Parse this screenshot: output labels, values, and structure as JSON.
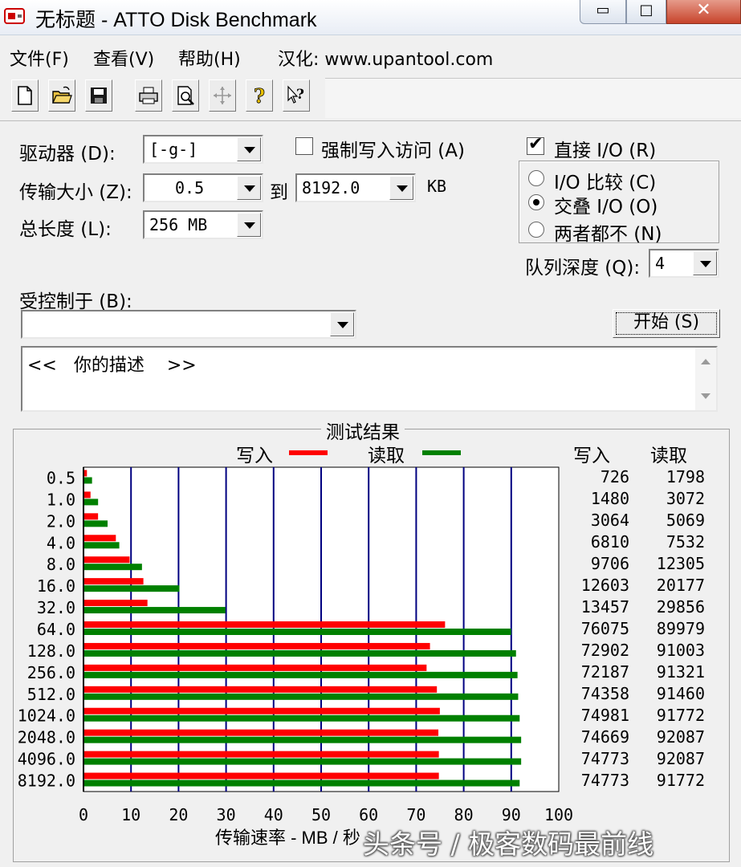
{
  "window": {
    "title": "无标题 - ATTO Disk Benchmark",
    "min_glyph": "▭",
    "max_glyph": "□",
    "close_glyph": "✕"
  },
  "menu": {
    "file": "文件(F)",
    "view": "查看(V)",
    "help": "帮助(H)",
    "localize": "汉化: www.upantool.com"
  },
  "toolbar": {
    "icons": [
      "new-file-icon",
      "open-folder-icon",
      "save-icon",
      "print-icon",
      "print-preview-icon",
      "move-icon",
      "help-icon",
      "context-help-icon"
    ]
  },
  "form": {
    "drive_label": "驱动器 (D):",
    "drive_value": "[-g-]",
    "force_write_label": "强制写入访问 (A)",
    "force_write_checked": false,
    "direct_io_label": "直接 I/O (R)",
    "direct_io_checked": true,
    "transfer_label": "传输大小 (Z):",
    "transfer_from": "0.5",
    "to_label": "到",
    "transfer_to": "8192.0",
    "kb_label": "KB",
    "total_label": "总长度 (L):",
    "total_value": "256 MB",
    "radio_compare": "I/O 比较 (C)",
    "radio_overlap": "交叠 I/O (O)",
    "radio_neither": "两者都不 (N)",
    "radio_selected": "overlap",
    "queue_label": "队列深度 (Q):",
    "queue_value": "4",
    "controlled_label": "受控制于 (B):",
    "controlled_value": "",
    "start_button": "开始 (S)",
    "description": "<<   你的描述    >>"
  },
  "results": {
    "title": "测试结果",
    "legend_write": "写入",
    "legend_read": "读取",
    "col_write": "写入",
    "col_read": "读取",
    "rows": [
      {
        "size": "0.5",
        "write": "726",
        "read": "1798"
      },
      {
        "size": "1.0",
        "write": "1480",
        "read": "3072"
      },
      {
        "size": "2.0",
        "write": "3064",
        "read": "5069"
      },
      {
        "size": "4.0",
        "write": "6810",
        "read": "7532"
      },
      {
        "size": "8.0",
        "write": "9706",
        "read": "12305"
      },
      {
        "size": "16.0",
        "write": "12603",
        "read": "20177"
      },
      {
        "size": "32.0",
        "write": "13457",
        "read": "29856"
      },
      {
        "size": "64.0",
        "write": "76075",
        "read": "89979"
      },
      {
        "size": "128.0",
        "write": "72902",
        "read": "91003"
      },
      {
        "size": "256.0",
        "write": "72187",
        "read": "91321"
      },
      {
        "size": "512.0",
        "write": "74358",
        "read": "91460"
      },
      {
        "size": "1024.0",
        "write": "74981",
        "read": "91772"
      },
      {
        "size": "2048.0",
        "write": "74669",
        "read": "92087"
      },
      {
        "size": "4096.0",
        "write": "74773",
        "read": "92087"
      },
      {
        "size": "8192.0",
        "write": "74773",
        "read": "91772"
      }
    ],
    "x_label": "传输速率 - MB / 秒",
    "watermark": "头条号 / 极客数码最前线"
  },
  "chart_data": {
    "type": "bar",
    "orientation": "horizontal",
    "title": "测试结果",
    "categories": [
      "0.5",
      "1.0",
      "2.0",
      "4.0",
      "8.0",
      "16.0",
      "32.0",
      "64.0",
      "128.0",
      "256.0",
      "512.0",
      "1024.0",
      "2048.0",
      "4096.0",
      "8192.0"
    ],
    "series": [
      {
        "name": "写入",
        "color": "#ff0000",
        "values": [
          0.726,
          1.48,
          3.064,
          6.81,
          9.706,
          12.603,
          13.457,
          76.075,
          72.902,
          72.187,
          74.358,
          74.981,
          74.669,
          74.773,
          74.773
        ]
      },
      {
        "name": "读取",
        "color": "#008000",
        "values": [
          1.798,
          3.072,
          5.069,
          7.532,
          12.305,
          20.177,
          29.856,
          89.979,
          91.003,
          91.321,
          91.46,
          91.772,
          92.087,
          92.087,
          91.772
        ]
      }
    ],
    "xlabel": "传输速率 - MB / 秒",
    "xlim": [
      0,
      100
    ],
    "xticks": [
      "0",
      "10",
      "20",
      "30",
      "40",
      "50",
      "60",
      "70",
      "80",
      "90",
      "100"
    ],
    "grid": true,
    "grid_color": "#000080"
  }
}
